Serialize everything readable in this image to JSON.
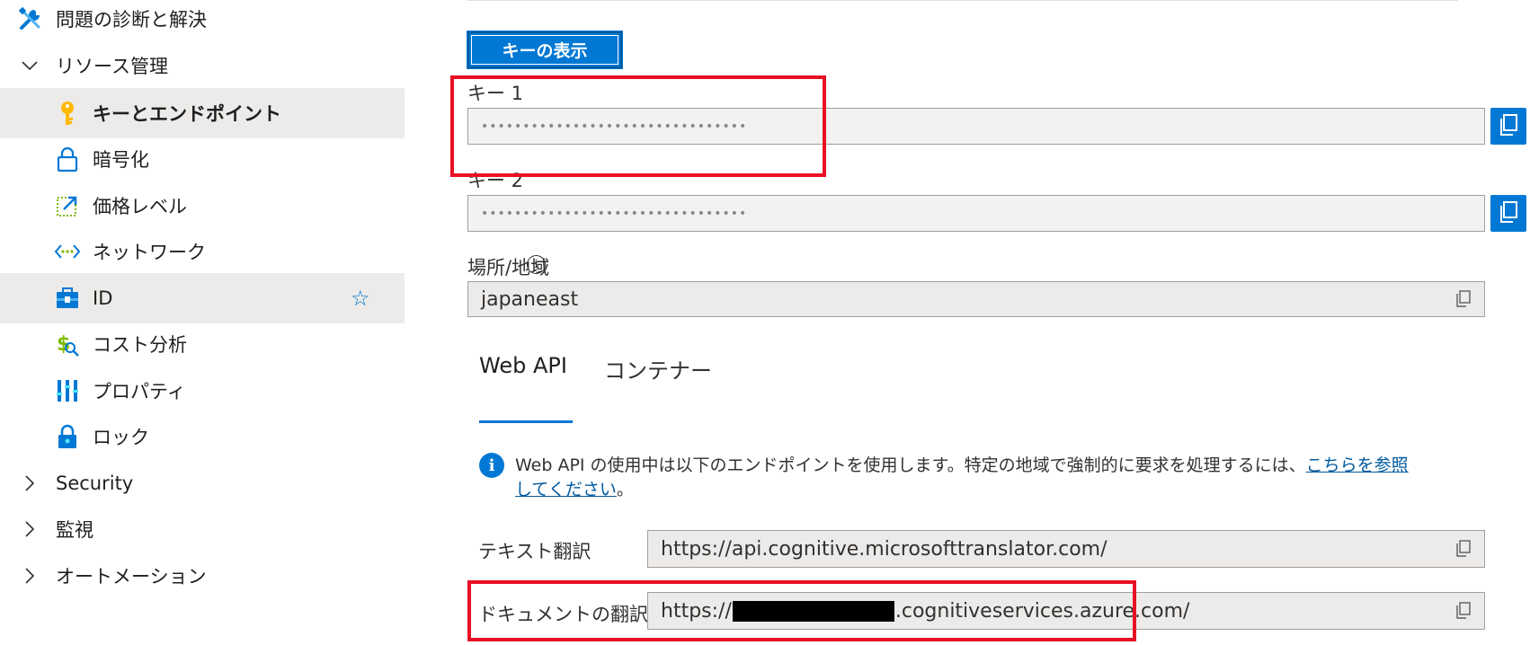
{
  "sidebar": {
    "items": [
      {
        "label": "問題の診断と解決",
        "icon": "wrench-screwdriver-icon"
      },
      {
        "label": "リソース管理",
        "icon": "chevron-down-icon"
      },
      {
        "label": "キーとエンドポイント",
        "icon": "key-icon",
        "selected": true
      },
      {
        "label": "暗号化",
        "icon": "lock-icon"
      },
      {
        "label": "価格レベル",
        "icon": "pricing-tier-icon"
      },
      {
        "label": "ネットワーク",
        "icon": "network-icon"
      },
      {
        "label": "ID",
        "icon": "identity-icon"
      },
      {
        "label": "コスト分析",
        "icon": "cost-analysis-icon"
      },
      {
        "label": "プロパティ",
        "icon": "properties-icon"
      },
      {
        "label": "ロック",
        "icon": "lock-shield-icon"
      },
      {
        "label": "Security",
        "icon": "chevron-right-icon"
      },
      {
        "label": "監視",
        "icon": "chevron-right-icon"
      },
      {
        "label": "オートメーション",
        "icon": "chevron-right-icon"
      }
    ]
  },
  "main": {
    "show_keys_label": "キーの表示",
    "key1_label": "キー 1",
    "key1_value": "••••••••••••••••••••••••••••••••",
    "key2_label": "キー 2",
    "key2_value": "••••••••••••••••••••••••••••••••",
    "location_label": "場所/地域",
    "location_info": "i",
    "location_value": "japaneast",
    "tabs": [
      {
        "label": "Web API",
        "active": true
      },
      {
        "label": "コンテナー",
        "active": false
      }
    ],
    "info_text": "Web API の使用中は以下のエンドポイントを使用します。特定の地域で強制的に要求を処理するには、",
    "info_link": "こちらを参照してください",
    "info_suffix": "。",
    "endpoints": [
      {
        "label": "テキスト翻訳",
        "value": "https://api.cognitive.microsofttranslator.com/"
      },
      {
        "label": "ドキュメントの翻訳",
        "value_prefix": "https://",
        "value_suffix": ".cognitiveservices.azure.com/"
      }
    ]
  },
  "colors": {
    "accent": "#0078d4",
    "highlight": "#e81123",
    "selected_bg": "#edebe9"
  }
}
